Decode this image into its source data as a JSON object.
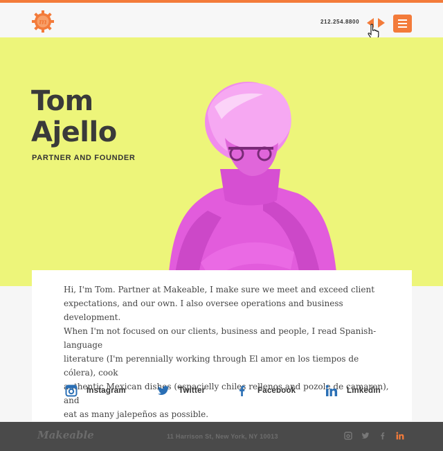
{
  "header": {
    "phone": "212.254.8800",
    "logo_mark": "m",
    "logo_icon": "gear-logo-icon",
    "arrows_icon": "left-right-arrows-icon",
    "menu_icon": "hamburger-menu-icon"
  },
  "profile": {
    "first_name": "Tom",
    "last_name": "Ajello",
    "role": "PARTNER AND FOUNDER",
    "bio": [
      "Hi, I'm Tom. Partner at Makeable, I make sure we meet and exceed client",
      "expectations, and our own. I also oversee operations and business development.",
      "When I'm not focused on our clients, business and people, I read Spanish-language",
      "literature (I'm perennially working through El amor en los tiempos de cólera), cook",
      "authentic Mexican dishes (espacielly chiles rellenos and pozole de camaron), and",
      "eat as many jalepeños as possible."
    ]
  },
  "social": [
    {
      "label": "Instagram",
      "icon": "instagram-icon"
    },
    {
      "label": "Twitter",
      "icon": "twitter-icon"
    },
    {
      "label": "Facebook",
      "icon": "facebook-icon"
    },
    {
      "label": "Linkedin",
      "icon": "linkedin-icon"
    }
  ],
  "footer": {
    "logo": "Makeable",
    "address": "11 Harrison St, New York, NY 10013",
    "icons": [
      "instagram-icon",
      "twitter-icon",
      "facebook-icon",
      "linkedin-icon"
    ]
  },
  "colors": {
    "accent": "#f37b3a",
    "hero_bg": "#edf57a",
    "photo_tint": "#e25cdc",
    "footer_bg": "#4a4a4a",
    "social_icon": "#2a6fb5"
  }
}
